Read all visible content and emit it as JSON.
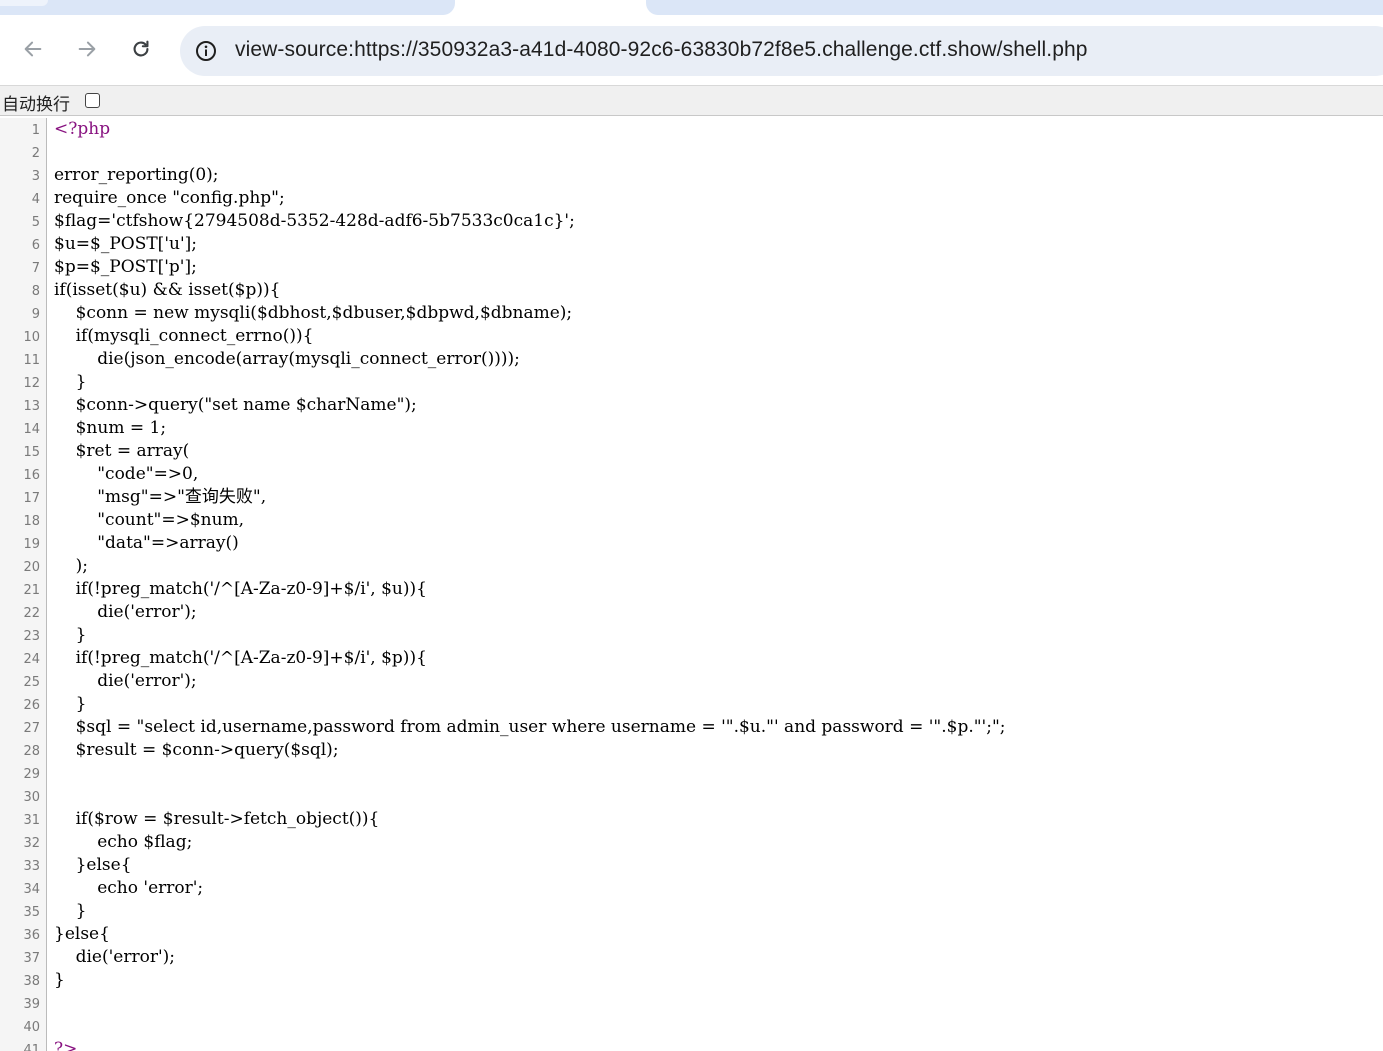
{
  "browser": {
    "url": "view-source:https://350932a3-a41d-4080-92c6-63830b72f8e5.challenge.ctf.show/shell.php"
  },
  "wrap": {
    "label": "自动换行"
  },
  "lines": [
    {
      "n": "1",
      "text": "<?php"
    },
    {
      "n": "2",
      "text": ""
    },
    {
      "n": "3",
      "text": "error_reporting(0);"
    },
    {
      "n": "4",
      "text": "require_once \"config.php\";"
    },
    {
      "n": "5",
      "text": "$flag='ctfshow{2794508d-5352-428d-adf6-5b7533c0ca1c}';"
    },
    {
      "n": "6",
      "text": "$u=$_POST['u'];"
    },
    {
      "n": "7",
      "text": "$p=$_POST['p'];"
    },
    {
      "n": "8",
      "text": "if(isset($u) && isset($p)){"
    },
    {
      "n": "9",
      "text": "    $conn = new mysqli($dbhost,$dbuser,$dbpwd,$dbname);"
    },
    {
      "n": "10",
      "text": "    if(mysqli_connect_errno()){"
    },
    {
      "n": "11",
      "text": "        die(json_encode(array(mysqli_connect_error())));"
    },
    {
      "n": "12",
      "text": "    }"
    },
    {
      "n": "13",
      "text": "    $conn->query(\"set name $charName\");"
    },
    {
      "n": "14",
      "text": "    $num = 1;"
    },
    {
      "n": "15",
      "text": "    $ret = array("
    },
    {
      "n": "16",
      "text": "        \"code\"=>0,"
    },
    {
      "n": "17",
      "text": "        \"msg\"=>\"查询失败\","
    },
    {
      "n": "18",
      "text": "        \"count\"=>$num,"
    },
    {
      "n": "19",
      "text": "        \"data\"=>array()"
    },
    {
      "n": "20",
      "text": "    );"
    },
    {
      "n": "21",
      "text": "    if(!preg_match('/^[A-Za-z0-9]+$/i', $u)){"
    },
    {
      "n": "22",
      "text": "        die('error');"
    },
    {
      "n": "23",
      "text": "    }"
    },
    {
      "n": "24",
      "text": "    if(!preg_match('/^[A-Za-z0-9]+$/i', $p)){"
    },
    {
      "n": "25",
      "text": "        die('error');"
    },
    {
      "n": "26",
      "text": "    }"
    },
    {
      "n": "27",
      "text": "    $sql = \"select id,username,password from admin_user where username = '\".$u.\"' and password = '\".$p.\"';\";"
    },
    {
      "n": "28",
      "text": "    $result = $conn->query($sql);"
    },
    {
      "n": "29",
      "text": ""
    },
    {
      "n": "30",
      "text": ""
    },
    {
      "n": "31",
      "text": "    if($row = $result->fetch_object()){"
    },
    {
      "n": "32",
      "text": "        echo $flag;"
    },
    {
      "n": "33",
      "text": "    }else{"
    },
    {
      "n": "34",
      "text": "        echo 'error';"
    },
    {
      "n": "35",
      "text": "    }"
    },
    {
      "n": "36",
      "text": "}else{"
    },
    {
      "n": "37",
      "text": "    die('error');"
    },
    {
      "n": "38",
      "text": "}"
    },
    {
      "n": "39",
      "text": ""
    },
    {
      "n": "40",
      "text": ""
    },
    {
      "n": "41",
      "text": "?>"
    }
  ]
}
